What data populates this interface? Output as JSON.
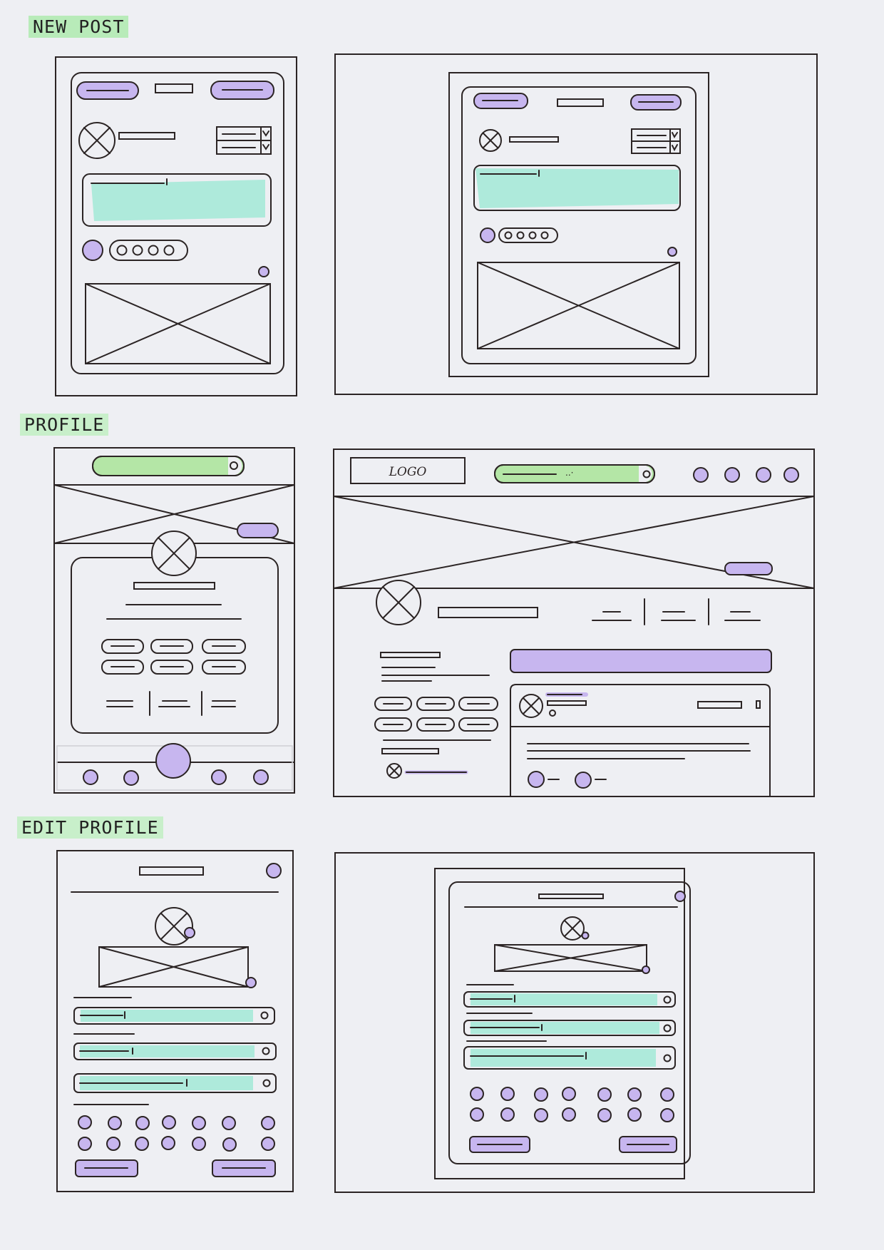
{
  "sections": {
    "new_post": "NEW POST",
    "profile": "PROFILE",
    "edit_profile": "EDIT PROFILE"
  },
  "profile_desktop": {
    "logo": "LOGO"
  },
  "colors": {
    "ink": "#2b2424",
    "paper": "#eeeff3",
    "purple": "#c7b6ef",
    "mint": "#aeeadb",
    "green": "#b4e6a6",
    "label_highlight": "#b8ebb9"
  }
}
